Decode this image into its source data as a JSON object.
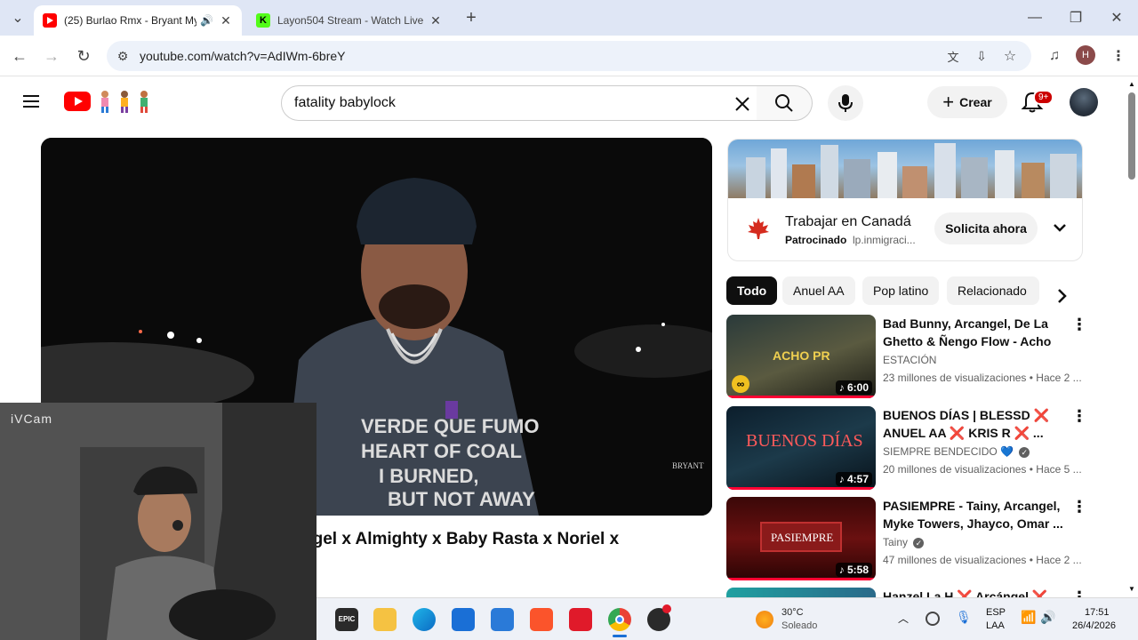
{
  "browser": {
    "tabs": [
      {
        "title": "(25) Burlao Rmx - Bryant My",
        "active": true
      },
      {
        "title": "Layon504 Stream - Watch Live o",
        "active": false
      }
    ],
    "url": "youtube.com/watch?v=AdIWm-6breY",
    "profile_initial": "H",
    "accent": "#dfe6f5"
  },
  "header": {
    "search_value": "fatality babylock",
    "create_label": "Crear",
    "notifications_badge": "9+"
  },
  "video": {
    "title": "ngel x Almighty x Baby Rasta x Noriel x",
    "shirt_text": "VERDE QUE FUMO / HEART OF COAL / I BURNED, BUT NOT AWAY",
    "watermark": "BRYANT"
  },
  "webcam": {
    "label": "iVCam"
  },
  "ad": {
    "title": "Trabajar en Canadá",
    "sponsor": "Patrocinado",
    "domain": "lp.inmigraci...",
    "cta": "Solicita ahora"
  },
  "chips": [
    "Todo",
    "Anuel AA",
    "Pop latino",
    "Relacionado"
  ],
  "recommendations": [
    {
      "title": "Bad Bunny, Arcangel, De La Ghetto & Ñengo Flow - Acho P...",
      "channel": "ESTACIÓN",
      "meta": "23 millones de visualizaciones • Hace 2 ...",
      "duration": "6:00",
      "thumb_text": "ACHO PR",
      "verified": false
    },
    {
      "title": "BUENOS DÍAS | BLESSD ❌ ANUEL AA ❌ KRIS R ❌ ...",
      "channel": "SIEMPRE BENDECIDO 💙",
      "meta": "20 millones de visualizaciones • Hace 5 ...",
      "duration": "4:57",
      "thumb_text": "BUENOS DÍAS",
      "verified": true
    },
    {
      "title": "PASIEMPRE - Tainy, Arcangel, Myke Towers, Jhayco, Omar ...",
      "channel": "Tainy",
      "meta": "47 millones de visualizaciones • Hace 2 ...",
      "duration": "5:58",
      "thumb_text": "PASIEMPRE",
      "verified": true
    },
    {
      "title": "Hanzel La H ❌ Arcángel ❌",
      "channel": "",
      "meta": "",
      "duration": "",
      "thumb_text": "",
      "verified": false
    }
  ],
  "taskbar": {
    "weather_temp": "30°C",
    "weather_desc": "Soleado",
    "lang_1": "ESP",
    "lang_2": "LAA",
    "time": "17:51",
    "date": "26/4/2026"
  }
}
